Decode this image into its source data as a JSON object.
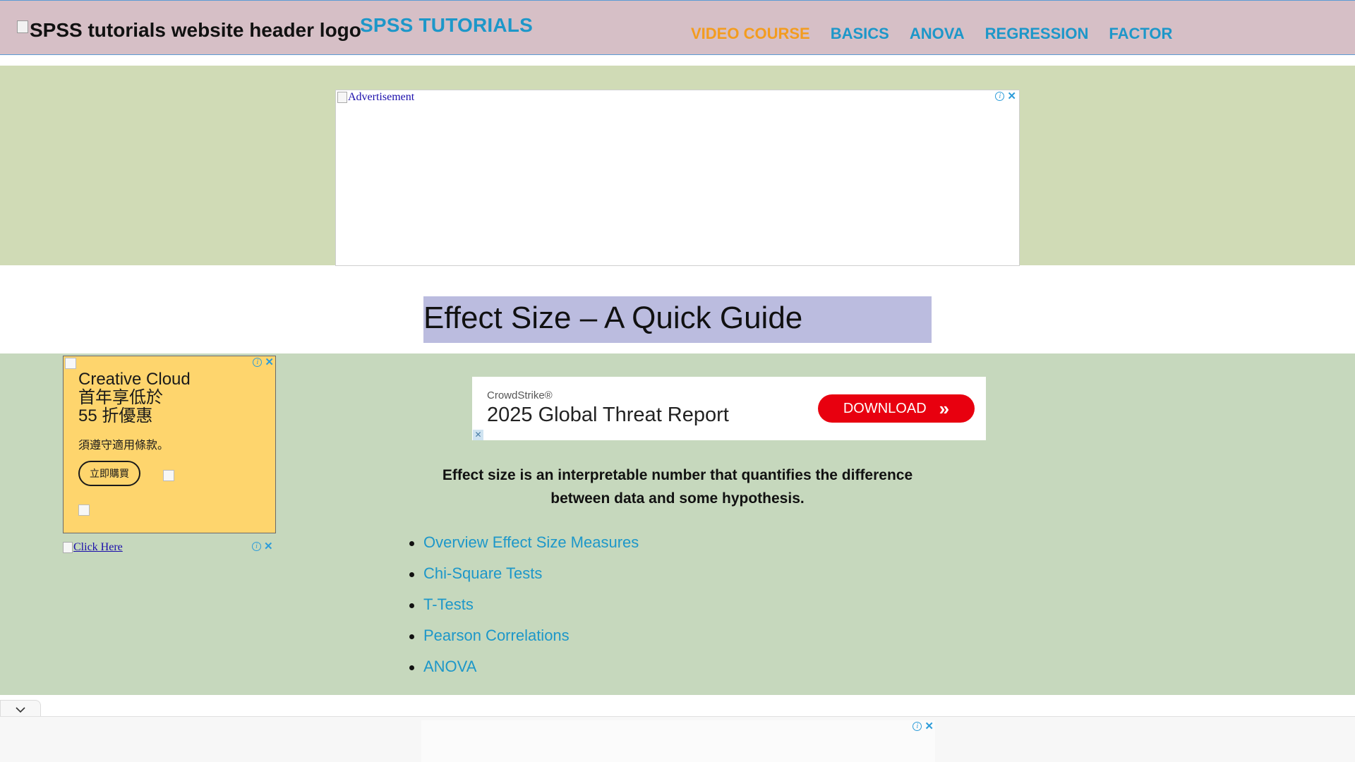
{
  "header": {
    "logo_alt": "SPSS tutorials website header logo",
    "site_title": "SPSS TUTORIALS",
    "nav": [
      {
        "label": "VIDEO COURSE",
        "highlight": true
      },
      {
        "label": "BASICS"
      },
      {
        "label": "ANOVA"
      },
      {
        "label": "REGRESSION"
      },
      {
        "label": "FACTOR"
      }
    ]
  },
  "top_ad": {
    "alt": "Advertisement",
    "info_icon": "adchoices-info-icon",
    "close_icon": "close-icon"
  },
  "page_title": "Effect Size – A Quick Guide",
  "side_ad": {
    "title_lines": [
      "Creative Cloud",
      "首年享低於",
      "55 折優惠"
    ],
    "terms": "須遵守適用條款。",
    "button": "立即購買"
  },
  "click_here_ad": {
    "alt": "Click Here"
  },
  "crowdstrike_ad": {
    "brand": "CrowdStrike®",
    "headline": "2025 Global Threat Report",
    "button": "DOWNLOAD",
    "chevron": "»",
    "close": "✕"
  },
  "intro": "Effect size is an interpretable number that quantifies the difference between data and some hypothesis.",
  "toc": [
    "Overview Effect Size Measures",
    "Chi-Square Tests",
    "T-Tests",
    "Pearson Correlations",
    "ANOVA"
  ],
  "colors": {
    "link": "#1d97c9",
    "nav_highlight": "#f39c1f",
    "header_bg": "#d6bfc6",
    "top_band_bg": "#d0dbb6",
    "content_band_bg": "#c6d8bd",
    "title_bg": "#bbbcdf",
    "side_ad_bg": "#fed56d",
    "download_btn": "#e8000f"
  }
}
